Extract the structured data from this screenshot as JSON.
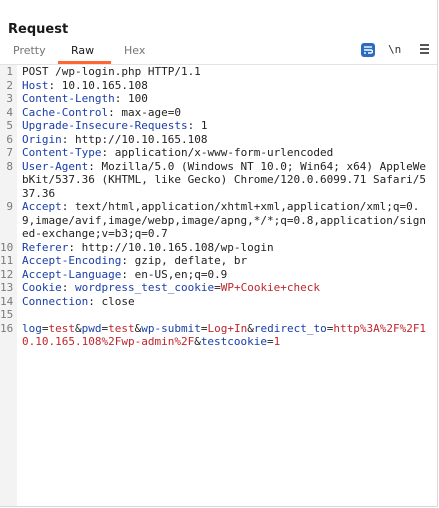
{
  "panel": {
    "title": "Request"
  },
  "tabs": [
    {
      "label": "Pretty",
      "active": false
    },
    {
      "label": "Raw",
      "active": true
    },
    {
      "label": "Hex",
      "active": false
    }
  ],
  "toolbar": {
    "wrap_icon": "wrap-lines-icon",
    "newline_label": "\\n",
    "menu_icon": "hamburger-menu-icon"
  },
  "colors": {
    "accent": "#ff6633",
    "header_key": "#1a3ea8",
    "value_red": "#c0262c",
    "tool_blue": "#2b6bc2"
  },
  "request": {
    "request_line": "POST /wp-login.php HTTP/1.1",
    "headers": [
      {
        "name": "Host",
        "value": "10.10.165.108"
      },
      {
        "name": "Content-Length",
        "value": "100"
      },
      {
        "name": "Cache-Control",
        "value": "max-age=0"
      },
      {
        "name": "Upgrade-Insecure-Requests",
        "value": "1"
      },
      {
        "name": "Origin",
        "value": "http://10.10.165.108"
      },
      {
        "name": "Content-Type",
        "value": "application/x-www-form-urlencoded"
      },
      {
        "name": "User-Agent",
        "value": "Mozilla/5.0 (Windows NT 10.0; Win64; x64) AppleWebKit/537.36 (KHTML, like Gecko) Chrome/120.0.6099.71 Safari/537.36"
      },
      {
        "name": "Accept",
        "value": "text/html,application/xhtml+xml,application/xml;q=0.9,image/avif,image/webp,image/apng,*/*;q=0.8,application/signed-exchange;v=b3;q=0.7"
      },
      {
        "name": "Referer",
        "value": "http://10.10.165.108/wp-login"
      },
      {
        "name": "Accept-Encoding",
        "value": "gzip, deflate, br"
      },
      {
        "name": "Accept-Language",
        "value": "en-US,en;q=0.9"
      },
      {
        "name": "Connection",
        "value": "close"
      }
    ],
    "cookie": {
      "label": "Cookie",
      "name": "wordpress_test_cookie",
      "value": "WP+Cookie+check"
    },
    "body_params": [
      {
        "key": "log",
        "value": "test"
      },
      {
        "key": "pwd",
        "value": "test"
      },
      {
        "key": "wp-submit",
        "value": "Log+In"
      },
      {
        "key": "redirect_to",
        "value": "http%3A%2F%2F10.10.165.108%2Fwp-admin%2F"
      },
      {
        "key": "testcookie",
        "value": "1"
      }
    ]
  },
  "line_numbers": [
    "1",
    "2",
    "3",
    "4",
    "5",
    "6",
    "7",
    "8",
    "9",
    "10",
    "11",
    "12",
    "13",
    "14",
    "15",
    "16"
  ]
}
